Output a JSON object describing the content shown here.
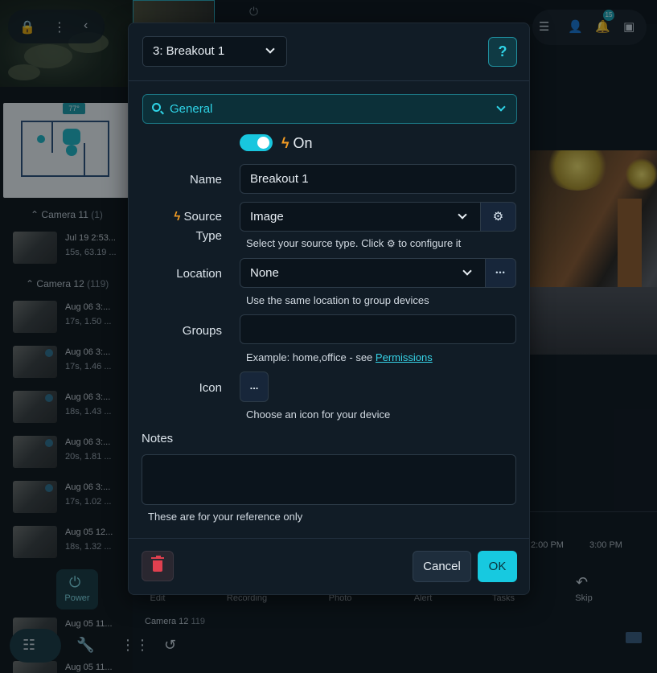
{
  "background": {
    "sidebar": {
      "floorplan_temp": "77°",
      "groups": [
        {
          "name": "Camera 11",
          "count": "(1)"
        },
        {
          "name": "Camera 12",
          "count": "(119)"
        }
      ],
      "recordings_cam11": [
        {
          "line1": "Jul 19 2:53...",
          "line2": "15s, 63.19 ..."
        }
      ],
      "recordings_cam12": [
        {
          "line1": "Aug 06 3:...",
          "line2": "17s, 1.50 ..."
        },
        {
          "line1": "Aug 06 3:...",
          "line2": "17s, 1.46 ..."
        },
        {
          "line1": "Aug 06 3:...",
          "line2": "18s, 1.43 ..."
        },
        {
          "line1": "Aug 06 3:...",
          "line2": "20s, 1.81 ..."
        },
        {
          "line1": "Aug 06 3:...",
          "line2": "17s, 1.02 ..."
        },
        {
          "line1": "Aug 05 12...",
          "line2": "18s, 1.32 ..."
        }
      ],
      "bottom_items": [
        {
          "line1": "Aug 05 11..."
        },
        {
          "line1": "Aug 05 11..."
        }
      ]
    },
    "notification_count": "15",
    "timeline_labels": [
      "2:00 PM",
      "3:00 PM"
    ],
    "action_bar": [
      "Power",
      "Edit",
      "Recording",
      "Photo",
      "Alert",
      "Tasks",
      "Skip"
    ],
    "camera12_label": "Camera 12",
    "camera12_count": "119",
    "accent_color": "#17c9e0"
  },
  "modal": {
    "device_select": "3: Breakout 1",
    "help_label": "?",
    "section_select": "General",
    "toggle_state": "On",
    "fields": {
      "name_label": "Name",
      "name_value": "Breakout 1",
      "source_type_label_1": "Source",
      "source_type_label_2": "Type",
      "source_type_value": "Image",
      "source_type_hint_1": "Select your source type. Click",
      "source_type_hint_2": "to configure it",
      "location_label": "Location",
      "location_value": "None",
      "location_addon": "•••",
      "location_hint": "Use the same location to group devices",
      "groups_label": "Groups",
      "groups_value": "",
      "groups_hint": "Example: home,office - see",
      "groups_hint_link": "Permissions",
      "icon_label": "Icon",
      "icon_button": "...",
      "icon_hint": "Choose an icon for your device",
      "notes_label": "Notes",
      "notes_value": "",
      "notes_hint": "These are for your reference only"
    },
    "footer": {
      "cancel": "Cancel",
      "ok": "OK"
    }
  }
}
